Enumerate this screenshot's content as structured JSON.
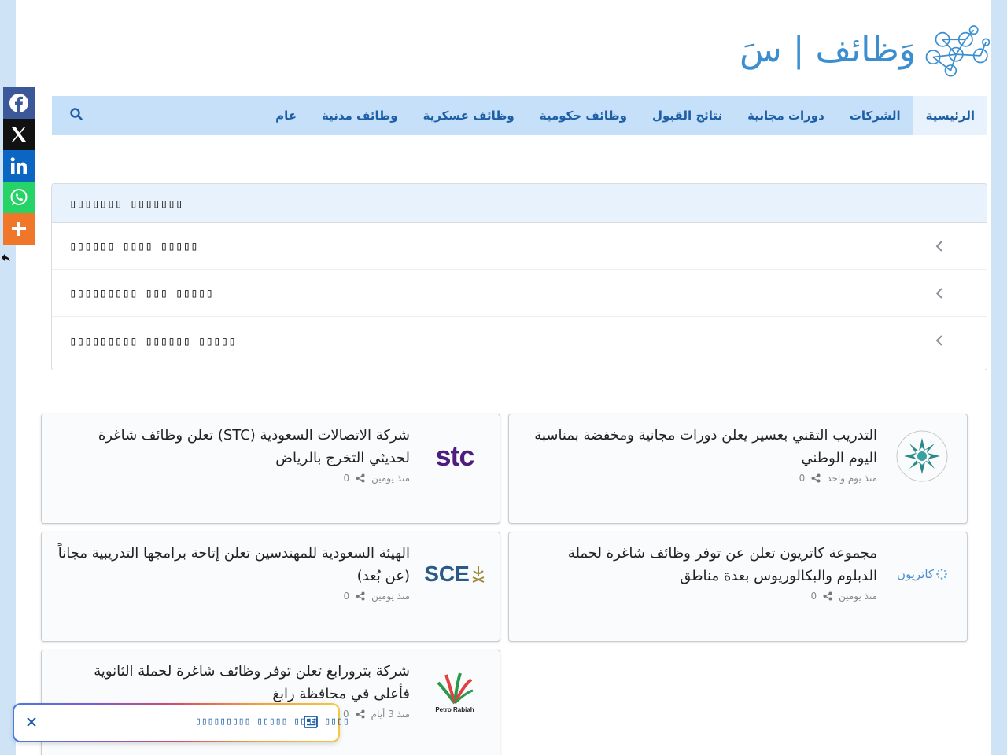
{
  "site": {
    "logo_text": "وَظائف | سَ",
    "accent": "#1d5ea5",
    "nav_bg": "#c6e0fa"
  },
  "nav": {
    "items": [
      {
        "label": "الرئيسية",
        "active": true
      },
      {
        "label": "الشركات"
      },
      {
        "label": "دورات مجانية"
      },
      {
        "label": "نتائج القبول"
      },
      {
        "label": "وظائف حكومية"
      },
      {
        "label": "وظائف عسكرية"
      },
      {
        "label": "وظائف مدنية"
      },
      {
        "label": "عام"
      }
    ],
    "search_icon": "search-icon"
  },
  "accordion": {
    "header": "▯▯▯▯▯▯▯ ▯▯▯▯▯▯▯",
    "rows": [
      {
        "label": "▯▯▯▯▯▯ ▯▯▯▯ ▯▯▯▯▯"
      },
      {
        "label": "▯▯▯▯▯▯▯▯▯ ▯▯▯ ▯▯▯▯▯"
      },
      {
        "label": "▯▯▯▯▯▯▯▯▯ ▯▯▯▯▯▯ ▯▯▯▯▯"
      }
    ]
  },
  "cards": [
    {
      "title": "التدريب التقني بعسير يعلن دورات مجانية ومخفضة بمناسبة اليوم الوطني",
      "date": "منذ يوم واحد",
      "shares": "0",
      "logo": "tvtc-logo"
    },
    {
      "title": "شركة الاتصالات السعودية (STC) تعلن وظائف شاغرة لحديثي التخرج بالرياض",
      "date": "منذ يومين",
      "shares": "0",
      "logo": "stc-logo",
      "logo_text": "stc"
    },
    {
      "title": "مجموعة كاتريون تعلن عن توفر وظائف شاغرة لحملة الدبلوم والبكالوريوس بعدة مناطق",
      "date": "منذ يومين",
      "shares": "0",
      "logo": "catrion-logo",
      "logo_text": "كاتريون"
    },
    {
      "title": "الهيئة السعودية للمهندسين تعلن إتاحة برامجها التدريبية مجاناً (عن بُعد)",
      "date": "منذ يومين",
      "shares": "0",
      "logo": "sce-logo",
      "logo_text": "SCE"
    },
    {
      "title": "شركة بترورابغ تعلن توفر وظائف شاغرة لحملة الثانوية فأعلى في محافظة رابغ",
      "date": "منذ 3 أيام",
      "shares": "0",
      "logo": "petro-rabigh-logo",
      "logo_text": "Petro Rabiah"
    }
  ],
  "social": [
    {
      "name": "facebook",
      "color": "#3b5998"
    },
    {
      "name": "x",
      "color": "#111111"
    },
    {
      "name": "linkedin",
      "color": "#0a66c2"
    },
    {
      "name": "whatsapp",
      "color": "#25d366"
    },
    {
      "name": "more",
      "color": "#f0762a"
    }
  ],
  "widget": {
    "text": "▯▯▯▯▯▯▯▯▯ ▯▯▯▯▯ ▯▯▯▯ ▯▯▯▯"
  }
}
